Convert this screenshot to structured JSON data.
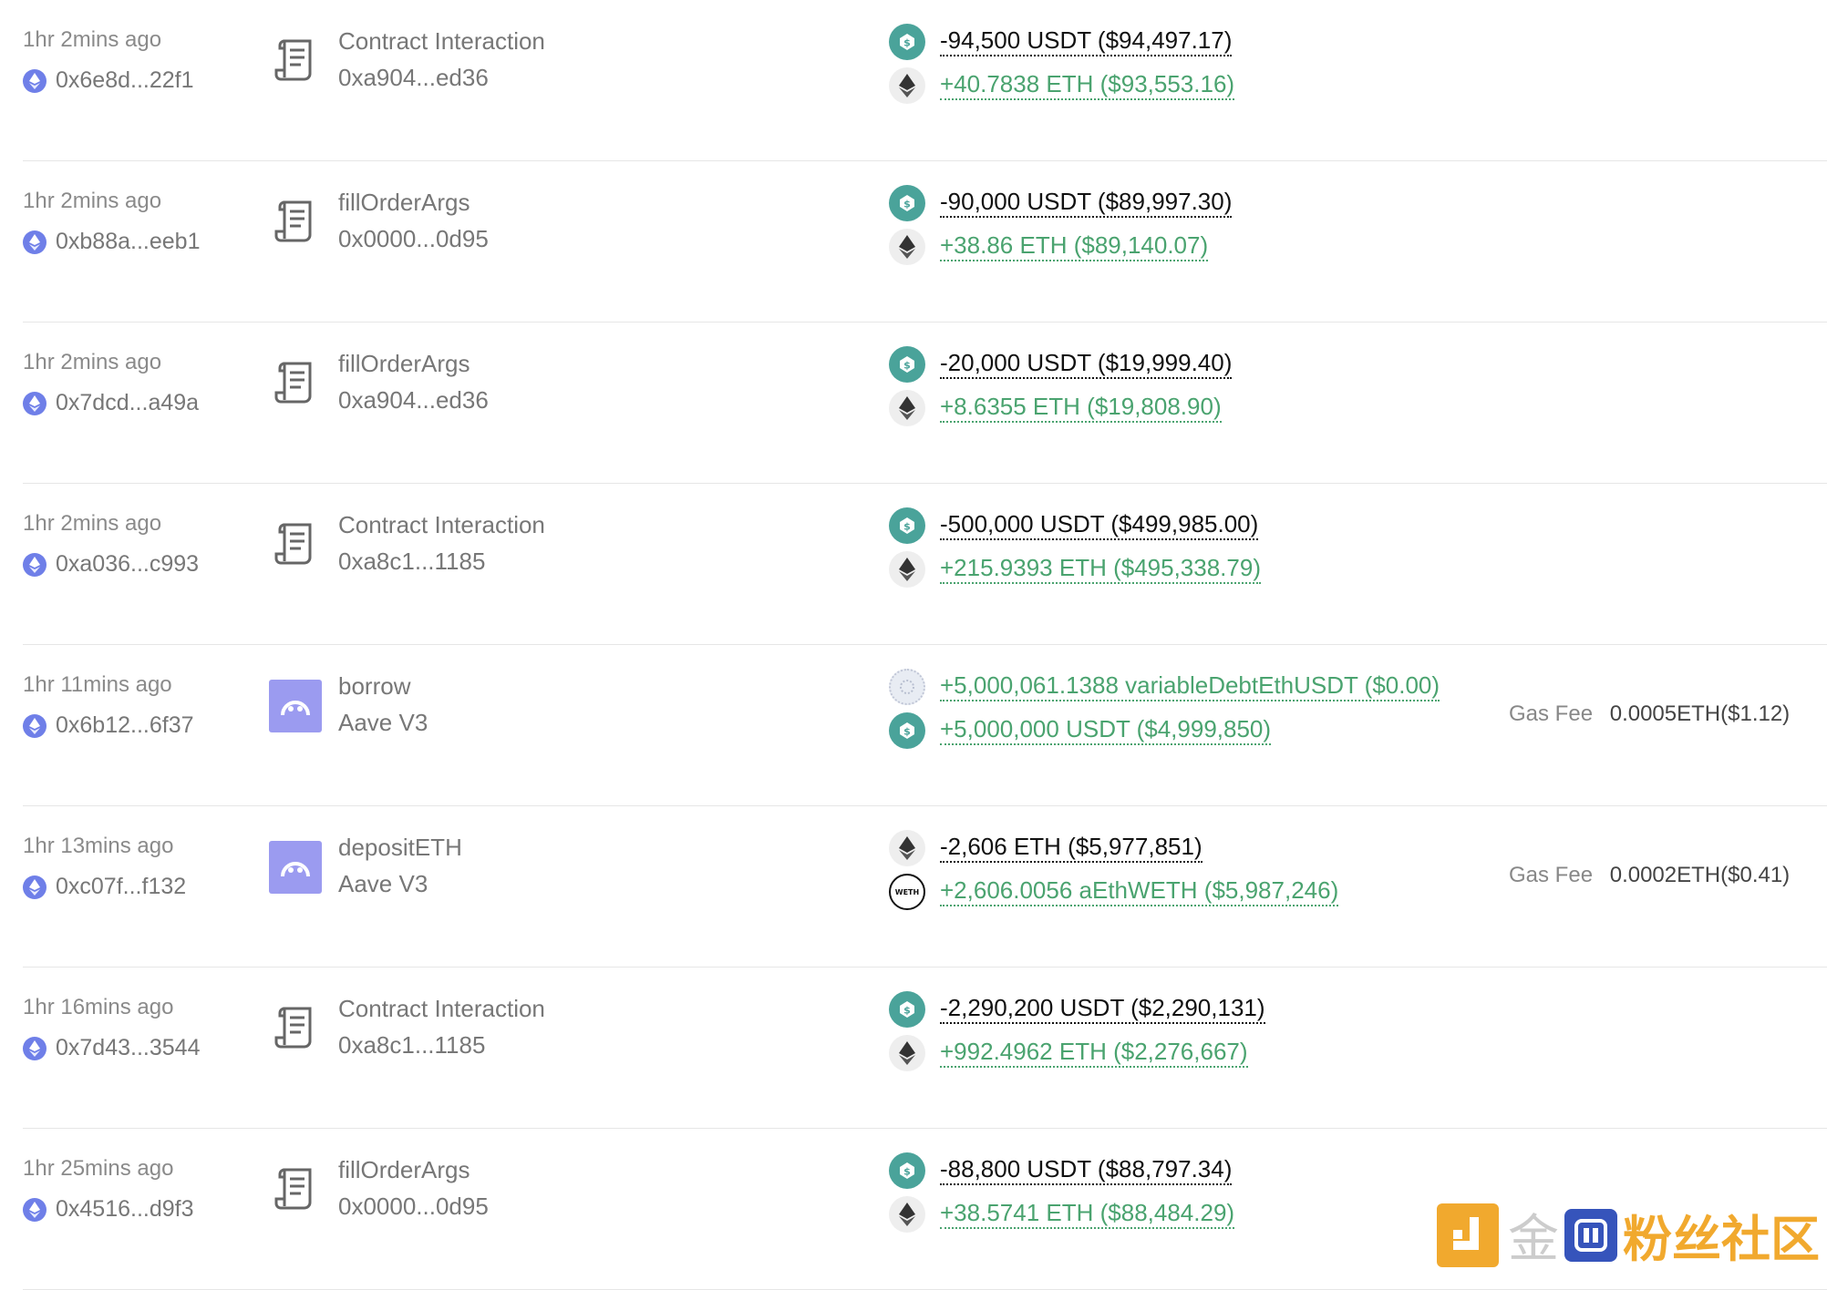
{
  "transactions": [
    {
      "time": "1hr 2mins ago",
      "hash": "0x6e8d...22f1",
      "type": "contract",
      "method": "Contract Interaction",
      "target": "0xa904...ed36",
      "flows": [
        {
          "token": "usdt",
          "sign": "neg",
          "text": "-94,500 USDT ($94,497.17)"
        },
        {
          "token": "eth",
          "sign": "pos",
          "text": "+40.7838 ETH ($93,553.16)"
        }
      ],
      "gas_label": "",
      "gas_value": ""
    },
    {
      "time": "1hr 2mins ago",
      "hash": "0xb88a...eeb1",
      "type": "contract",
      "method": "fillOrderArgs",
      "target": "0x0000...0d95",
      "flows": [
        {
          "token": "usdt",
          "sign": "neg",
          "text": "-90,000 USDT ($89,997.30)"
        },
        {
          "token": "eth",
          "sign": "pos",
          "text": "+38.86 ETH ($89,140.07)"
        }
      ],
      "gas_label": "",
      "gas_value": ""
    },
    {
      "time": "1hr 2mins ago",
      "hash": "0x7dcd...a49a",
      "type": "contract",
      "method": "fillOrderArgs",
      "target": "0xa904...ed36",
      "flows": [
        {
          "token": "usdt",
          "sign": "neg",
          "text": "-20,000 USDT ($19,999.40)"
        },
        {
          "token": "eth",
          "sign": "pos",
          "text": "+8.6355 ETH ($19,808.90)"
        }
      ],
      "gas_label": "",
      "gas_value": ""
    },
    {
      "time": "1hr 2mins ago",
      "hash": "0xa036...c993",
      "type": "contract",
      "method": "Contract Interaction",
      "target": "0xa8c1...1185",
      "flows": [
        {
          "token": "usdt",
          "sign": "neg",
          "text": "-500,000 USDT ($499,985.00)"
        },
        {
          "token": "eth",
          "sign": "pos",
          "text": "+215.9393 ETH ($495,338.79)"
        }
      ],
      "gas_label": "",
      "gas_value": ""
    },
    {
      "time": "1hr 11mins ago",
      "hash": "0x6b12...6f37",
      "type": "aave",
      "method": "borrow",
      "target": "Aave V3",
      "flows": [
        {
          "token": "debt",
          "sign": "pos",
          "text": "+5,000,061.1388 variableDebtEthUSDT ($0.00)"
        },
        {
          "token": "usdt",
          "sign": "pos",
          "text": "+5,000,000 USDT ($4,999,850)"
        }
      ],
      "gas_label": "Gas Fee",
      "gas_value": "0.0005ETH($1.12)"
    },
    {
      "time": "1hr 13mins ago",
      "hash": "0xc07f...f132",
      "type": "aave",
      "method": "depositETH",
      "target": "Aave V3",
      "flows": [
        {
          "token": "eth",
          "sign": "neg",
          "text": "-2,606 ETH ($5,977,851)"
        },
        {
          "token": "aeth",
          "sign": "pos",
          "text": "+2,606.0056 aEthWETH ($5,987,246)"
        }
      ],
      "gas_label": "Gas Fee",
      "gas_value": "0.0002ETH($0.41)"
    },
    {
      "time": "1hr 16mins ago",
      "hash": "0x7d43...3544",
      "type": "contract",
      "method": "Contract Interaction",
      "target": "0xa8c1...1185",
      "flows": [
        {
          "token": "usdt",
          "sign": "neg",
          "text": "-2,290,200 USDT ($2,290,131)"
        },
        {
          "token": "eth",
          "sign": "pos",
          "text": "+992.4962 ETH ($2,276,667)"
        }
      ],
      "gas_label": "",
      "gas_value": ""
    },
    {
      "time": "1hr 25mins ago",
      "hash": "0x4516...d9f3",
      "type": "contract",
      "method": "fillOrderArgs",
      "target": "0x0000...0d95",
      "flows": [
        {
          "token": "usdt",
          "sign": "neg",
          "text": "-88,800 USDT ($88,797.34)"
        },
        {
          "token": "eth",
          "sign": "pos",
          "text": "+38.5741 ETH ($88,484.29)"
        }
      ],
      "gas_label": "",
      "gas_value": ""
    }
  ],
  "watermark": {
    "gray_text": "金",
    "brand_text": "粉丝社区"
  },
  "colors": {
    "usdt": "#4aa39a",
    "positive": "#4aa36f",
    "negative": "#111111",
    "aave": "#9b9bf0",
    "chain": "#6f7fe8"
  }
}
